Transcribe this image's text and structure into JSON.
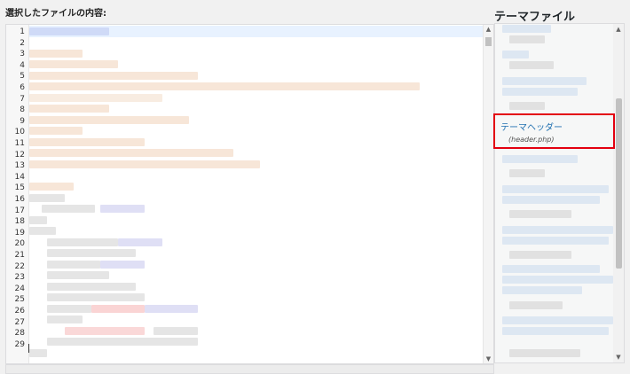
{
  "editor": {
    "label": "選択したファイルの内容:",
    "line_numbers": [
      "1",
      "2",
      "3",
      "4",
      "5",
      "6",
      "7",
      "8",
      "9",
      "10",
      "11",
      "12",
      "13",
      "14",
      "15",
      "16",
      "17",
      "18",
      "19",
      "20",
      "21",
      "22",
      "23",
      "24",
      "25",
      "26",
      "27",
      "28",
      "29"
    ]
  },
  "sidebar": {
    "title": "テーマファイル",
    "selected_file": {
      "name": "テーマヘッダー",
      "filename": "(header.php)"
    }
  },
  "colors": {
    "link": "#2271b1",
    "highlight": "#e3000f",
    "active_line": "#e8f2ff"
  }
}
